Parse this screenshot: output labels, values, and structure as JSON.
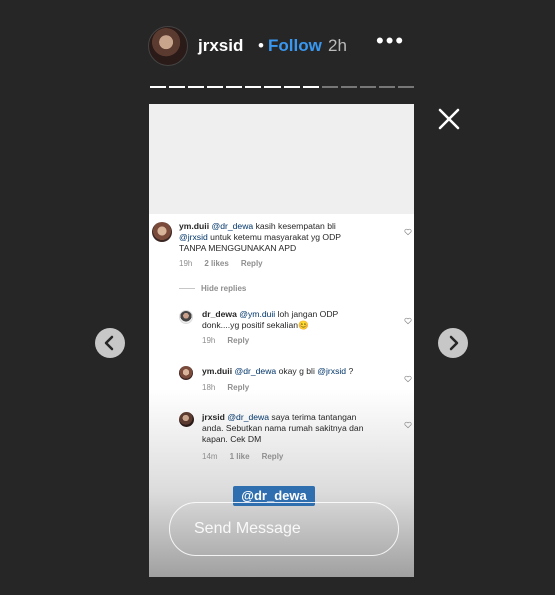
{
  "header": {
    "username": "jrxsid",
    "separator": "•",
    "follow_label": "Follow",
    "time": "2h",
    "more": "•••"
  },
  "progress": {
    "segments_total": 14,
    "segments_viewed": 9
  },
  "story": {
    "comments": [
      {
        "username": "ym.duii",
        "mention": "@dr_dewa",
        "text_a": " kasih kesempatan bli",
        "mention2": "@jrxsid",
        "text_b": " untuk ketemu masyarakat yg ODP",
        "text_c": "TANPA MENGGUNAKAN APD",
        "time": "19h",
        "likes": "2 likes",
        "reply": "Reply"
      },
      {
        "username": "dr_dewa",
        "mention": "@ym.duii",
        "text_a": " loh jangan ODP",
        "text_b": "donk....yg positif sekalian",
        "emoji": "😊",
        "time": "19h",
        "reply": "Reply"
      },
      {
        "username": "ym.duii",
        "mention": "@dr_dewa",
        "text_a": " okay g bli ",
        "mention2": "@jrxsid",
        "text_b": " ?",
        "time": "18h",
        "reply": "Reply"
      },
      {
        "username": "jrxsid",
        "mention": "@dr_dewa",
        "text_a": " saya terima tantangan",
        "text_b": "anda. Sebutkan nama rumah sakitnya dan",
        "text_c": "kapan. Cek DM",
        "time": "14m",
        "likes": "1 like",
        "reply": "Reply"
      }
    ],
    "hide_replies": "Hide replies",
    "mention_sticker": "@dr_dewa",
    "send_placeholder": "Send Message"
  },
  "colors": {
    "background": "#262626",
    "follow": "#3897f0",
    "mention": "#003569",
    "sticker": "#2f6fb0"
  },
  "icons": {
    "close": "close-icon",
    "prev": "chevron-left-icon",
    "next": "chevron-right-icon",
    "like": "heart-icon"
  }
}
